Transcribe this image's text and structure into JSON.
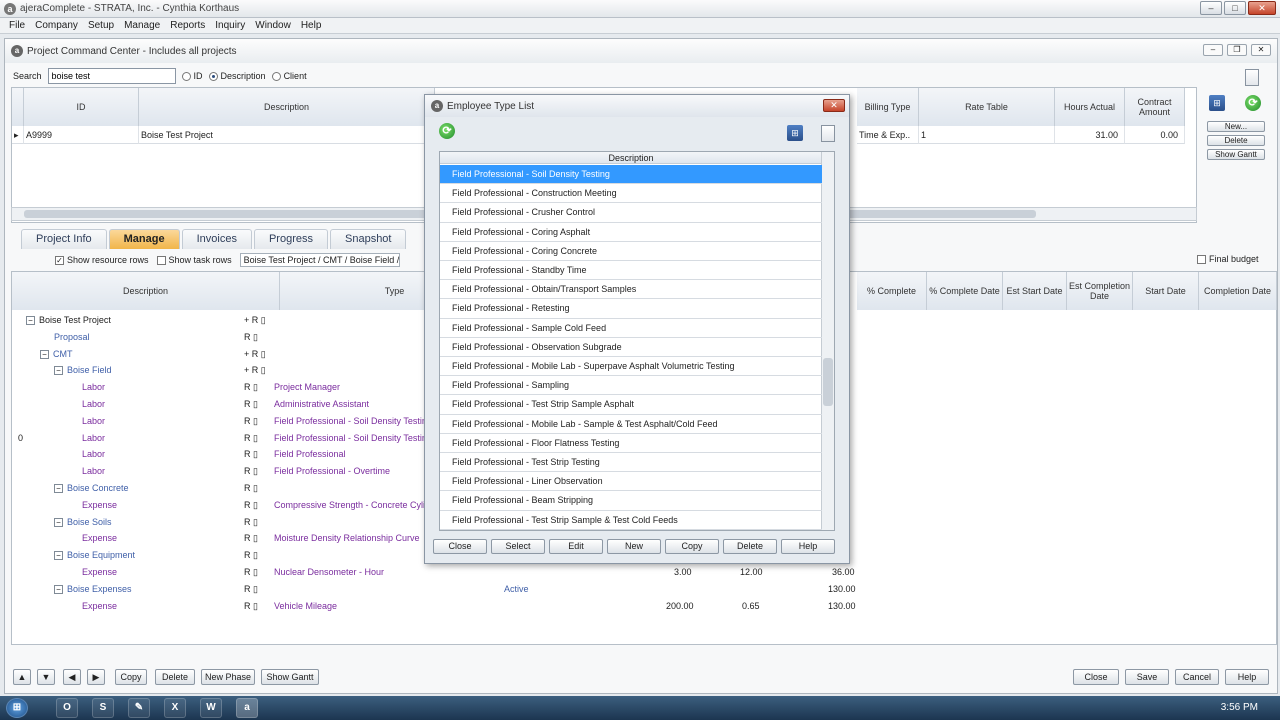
{
  "app": {
    "title": "ajeraComplete  -  STRATA, Inc.  -  Cynthia Korthaus",
    "menu": [
      "File",
      "Company",
      "Setup",
      "Manage",
      "Reports",
      "Inquiry",
      "Window",
      "Help"
    ]
  },
  "window": {
    "title": "Project Command Center - Includes all projects"
  },
  "search": {
    "label": "Search",
    "value": "boise test",
    "options": [
      "ID",
      "Description",
      "Client"
    ]
  },
  "grid1": {
    "headers": [
      "ID",
      "Description",
      "Billing Type",
      "Rate Table",
      "Hours Actual",
      "Contract Amount"
    ],
    "row": {
      "id": "A9999",
      "description": "Boise Test Project",
      "billing_type": "Time & Exp..",
      "rate_table": "1",
      "hours_actual": "31.00",
      "contract_amount": "0.00"
    }
  },
  "side_buttons": [
    "New...",
    "Delete",
    "Show Gantt"
  ],
  "tabs": [
    "Project Info",
    "Manage",
    "Invoices",
    "Progress",
    "Snapshot"
  ],
  "options": {
    "show_resource_rows": "Show resource rows",
    "show_task_rows": "Show task rows",
    "breadcrumb": "Boise Test Project / CMT / Boise Field / Labor",
    "final_budget": "Final budget"
  },
  "grid2": {
    "headers": {
      "description": "Description",
      "type": "Type",
      "pct_complete": "% Complete",
      "pct_complete_date": "% Complete Date",
      "est_start": "Est Start Date",
      "est_completion": "Est Completion Date",
      "start_date": "Start Date",
      "completion_date": "Completion Date"
    },
    "rows": [
      {
        "desc": "Boise Test Project",
        "type": "",
        "pre": ""
      },
      {
        "desc": "Proposal",
        "type": "",
        "pre": ""
      },
      {
        "desc": "CMT",
        "type": "",
        "pre": ""
      },
      {
        "desc": "Boise Field",
        "type": "",
        "pre": ""
      },
      {
        "desc": "Labor",
        "type": "Project Manager",
        "pre": ""
      },
      {
        "desc": "Labor",
        "type": "Administrative Assistant",
        "pre": ""
      },
      {
        "desc": "Labor",
        "type": "Field Professional - Soil Density Testing",
        "pre": ""
      },
      {
        "desc": "Labor",
        "type": "Field Professional - Soil Density Testing",
        "pre": "0"
      },
      {
        "desc": "Labor",
        "type": "Field Professional",
        "pre": ""
      },
      {
        "desc": "Labor",
        "type": "Field Professional - Overtime",
        "pre": ""
      },
      {
        "desc": "Boise Concrete",
        "type": "",
        "pre": ""
      },
      {
        "desc": "Expense",
        "type": "Compressive Strength - Concrete Cylinders",
        "pre": ""
      },
      {
        "desc": "Boise Soils",
        "type": "",
        "pre": ""
      },
      {
        "desc": "Expense",
        "type": "Moisture Density Relationship Curve",
        "pre": ""
      },
      {
        "desc": "Boise Equipment",
        "type": "",
        "pre": ""
      },
      {
        "desc": "Expense",
        "type": "Nuclear Densometer - Hour",
        "pre": ""
      },
      {
        "desc": "Boise Expenses",
        "type": "",
        "pre": ""
      },
      {
        "desc": "Expense",
        "type": "Vehicle Mileage",
        "pre": ""
      }
    ],
    "extra": {
      "r15": {
        "a": "3.00",
        "b": "12.00",
        "c": "36.00"
      },
      "r16": {
        "status": "Active",
        "c": "130.00"
      },
      "r17": {
        "a": "200.00",
        "b": "0.65",
        "c": "130.00"
      }
    }
  },
  "bottom": {
    "left": [
      "Copy",
      "Delete",
      "New Phase",
      "Show Gantt"
    ],
    "right": [
      "Close",
      "Save",
      "Cancel",
      "Help"
    ]
  },
  "dialog": {
    "title": "Employee Type List",
    "column": "Description",
    "items": [
      "Field Professional - Soil Density Testing",
      "Field Professional - Construction Meeting",
      "Field Professional - Crusher Control",
      "Field Professional - Coring Asphalt",
      "Field Professional - Coring Concrete",
      "Field Professional - Standby Time",
      "Field Professional - Obtain/Transport Samples",
      "Field Professional - Retesting",
      "Field Professional - Sample Cold Feed",
      "Field Professional - Observation Subgrade",
      "Field Professional - Mobile Lab - Superpave Asphalt Volumetric Testing",
      "Field Professional - Sampling",
      "Field Professional - Test Strip Sample Asphalt",
      "Field Professional - Mobile Lab - Sample & Test Asphalt/Cold Feed",
      "Field Professional - Floor Flatness Testing",
      "Field Professional - Test Strip Testing",
      "Field Professional - Liner Observation",
      "Field Professional - Beam Stripping",
      "Field Professional - Test Strip Sample & Test Cold Feeds"
    ],
    "buttons": [
      "Close",
      "Select",
      "Edit",
      "New",
      "Copy",
      "Delete",
      "Help"
    ]
  },
  "taskbar": {
    "time": "3:56 PM"
  }
}
